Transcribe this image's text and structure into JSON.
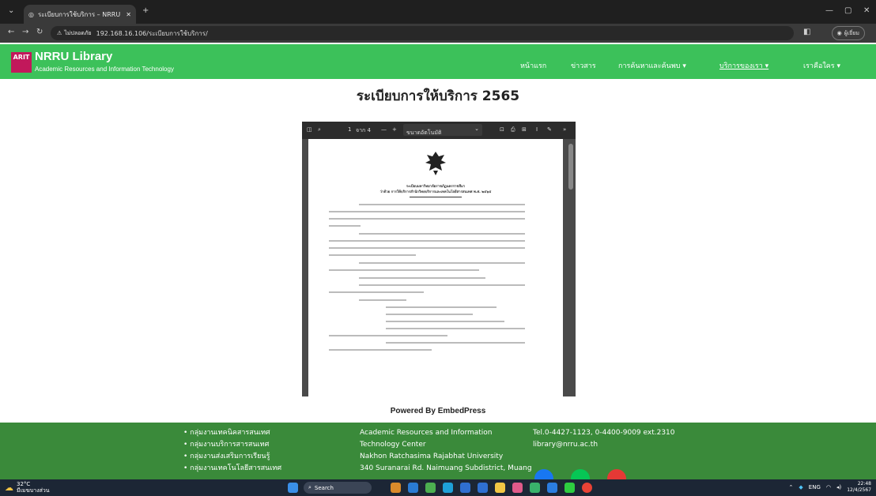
{
  "browser": {
    "tab_title": "ระเบียบการใช้บริการ – NRRU Libra",
    "security_label": "ไม่ปลอดภัย",
    "url": "192.168.16.106/ระเบียบการใช้บริการ/",
    "profile_label": "ผู้เยี่ยม"
  },
  "site": {
    "logo_text": "ARIT",
    "name": "NRRU Library",
    "subtitle": "Academic Resources and Information Technology",
    "nav": [
      {
        "label": "หน้าแรก"
      },
      {
        "label": "ข่าวสาร"
      },
      {
        "label": "การค้นหาและค้นพบ ▾"
      },
      {
        "label": "บริการของเรา ▾"
      },
      {
        "label": "เราคือใคร ▾"
      }
    ]
  },
  "main": {
    "title": "ระเบียบการให้บริการ 2565",
    "powered_by": "Powered By EmbedPress"
  },
  "pdf": {
    "page_number": "1",
    "page_total": "จาก 4",
    "zoom_label": "ขนาดอัตโนมัติ",
    "doc_heading": "ระเบียบมหาวิทยาลัยราชภัฏนครราชสีมา",
    "doc_subheading": "ว่าด้วย การให้บริการสำนักวิทยบริการและเทคโนโลยีสารสนเทศ พ.ศ. ๒๕๖๕"
  },
  "footer": {
    "links": [
      "• กลุ่มงานเทคนิคสารสนเทศ",
      "• กลุ่มงานบริการสารสนเทศ",
      "• กลุ่มงานส่งเสริมการเรียนรู้",
      "• กลุ่มงานเทคโนโลยีสารสนเทศ"
    ],
    "address": [
      "Academic Resources and Information",
      "Technology Center",
      "Nakhon Ratchasima Rajabhat University",
      "340 Suranarai Rd. Naimuang Subdistrict, Muang"
    ],
    "phone": "Tel.0-4427-1123, 0-4400-9009 ext.2310",
    "email": "library@nrru.ac.th"
  },
  "taskbar": {
    "temperature": "32°C",
    "weather_text": "มีเมฆบางส่วน",
    "search_label": "Search",
    "language": "ENG",
    "time": "22:48",
    "date": "12/4/2567"
  }
}
